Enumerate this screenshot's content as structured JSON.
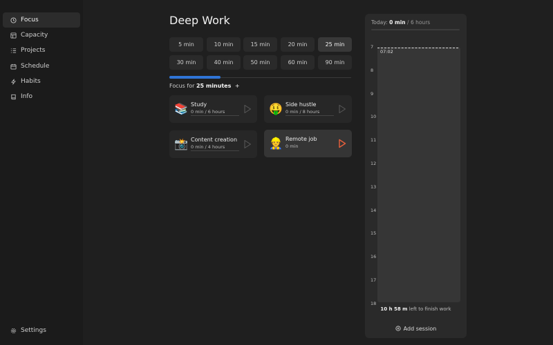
{
  "sidebar": {
    "items": [
      {
        "label": "Focus",
        "icon": "clock-icon"
      },
      {
        "label": "Capacity",
        "icon": "layout-icon"
      },
      {
        "label": "Projects",
        "icon": "list-icon"
      },
      {
        "label": "Schedule",
        "icon": "calendar-icon"
      },
      {
        "label": "Habits",
        "icon": "bolt-icon"
      },
      {
        "label": "Info",
        "icon": "book-icon"
      }
    ],
    "settings_label": "Settings"
  },
  "main": {
    "title": "Deep Work",
    "durations": [
      "5 min",
      "10 min",
      "15 min",
      "20 min",
      "25 min",
      "30 min",
      "40 min",
      "50 min",
      "60 min",
      "90 min"
    ],
    "selected_duration": "25 min",
    "focus_prefix": "Focus for",
    "focus_value": "25 minutes",
    "focus_plus": "+",
    "progress_fraction": 0.28,
    "accent_color": "#2f74d6",
    "projects": [
      {
        "name": "Study",
        "detail": "0 min / 6 hours",
        "emoji": "📚",
        "active": false
      },
      {
        "name": "Side hustle",
        "detail": "0 min / 8 hours",
        "emoji": "🤑",
        "active": false
      },
      {
        "name": "Content creation",
        "detail": "0 min / 4 hours",
        "emoji": "📸",
        "active": false
      },
      {
        "name": "Remote job",
        "detail": "0 min",
        "emoji": "👷",
        "active": true
      }
    ],
    "play_active_color": "#e8603c"
  },
  "panel": {
    "today_label": "Today:",
    "today_value": "0 min",
    "today_sep": "/",
    "today_goal": "6 hours",
    "now_label": "07:02",
    "hours": [
      "7",
      "8",
      "9",
      "10",
      "11",
      "12",
      "13",
      "14",
      "15",
      "16",
      "17",
      "18"
    ],
    "left_value": "10 h 58 m",
    "left_suffix": "left to finish work",
    "add_session_label": "Add session"
  }
}
